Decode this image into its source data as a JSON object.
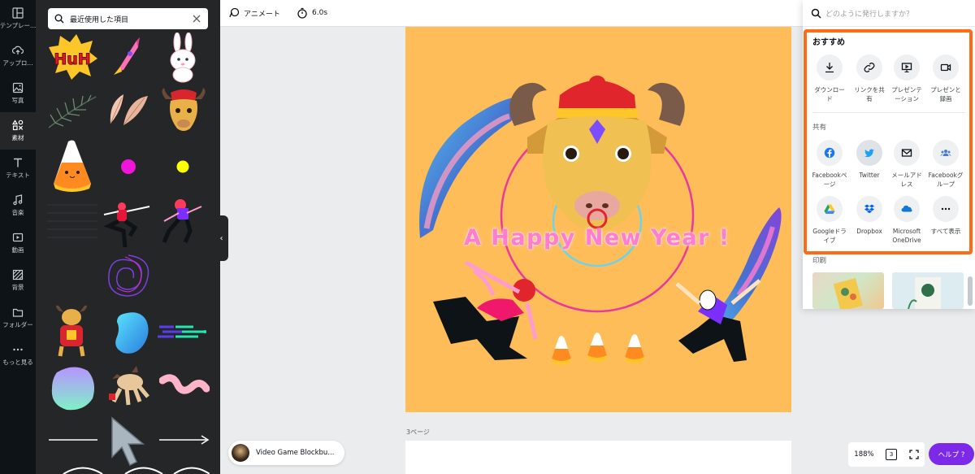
{
  "rail": [
    {
      "id": "template",
      "label": "テンプレー...",
      "icon": "template-icon"
    },
    {
      "id": "upload",
      "label": "アップロ...",
      "icon": "cloud-upload-icon"
    },
    {
      "id": "photo",
      "label": "写真",
      "icon": "photo-icon"
    },
    {
      "id": "elements",
      "label": "素材",
      "icon": "shapes-icon",
      "active": true
    },
    {
      "id": "text",
      "label": "テキスト",
      "icon": "text-icon"
    },
    {
      "id": "audio",
      "label": "音楽",
      "icon": "music-icon"
    },
    {
      "id": "video",
      "label": "動画",
      "icon": "video-icon"
    },
    {
      "id": "background",
      "label": "背景",
      "icon": "background-icon"
    },
    {
      "id": "folder",
      "label": "フォルダー",
      "icon": "folder-icon"
    },
    {
      "id": "more",
      "label": "もっと見る",
      "icon": "more-icon"
    }
  ],
  "panel": {
    "search_query": "最近使用した項目"
  },
  "toolbar": {
    "animate_label": "アニメート",
    "duration": "6.0s"
  },
  "canvas": {
    "title": "A Happy New Year !"
  },
  "page_label": "3ページ",
  "audio_track": "Video Game Blockbu...",
  "zoom": "188%",
  "page_count": "3",
  "help_label": "ヘルプ ?",
  "share": {
    "search_placeholder": "どのように発行しますか？",
    "recommended_title": "おすすめ",
    "recommended": [
      {
        "label": "ダウンロード",
        "icon": "download-icon"
      },
      {
        "label": "リンクを共有",
        "icon": "link-icon"
      },
      {
        "label": "プレゼンテーション",
        "icon": "present-icon"
      },
      {
        "label": "プレゼンと録画",
        "icon": "record-icon"
      }
    ],
    "share_title": "共有",
    "share_items": [
      {
        "label": "Facebookページ",
        "icon": "facebook-icon",
        "color": "#1877f2"
      },
      {
        "label": "Twitter",
        "icon": "twitter-icon",
        "color": "#1da1f2"
      },
      {
        "label": "メールアドレス",
        "icon": "mail-icon",
        "color": "#3c4043"
      },
      {
        "label": "Facebookグループ",
        "icon": "facebook-group-icon",
        "color": "#4a7cd3"
      },
      {
        "label": "Googleドライブ",
        "icon": "google-drive-icon",
        "color": "#1fa463"
      },
      {
        "label": "Dropbox",
        "icon": "dropbox-icon",
        "color": "#0061fe"
      },
      {
        "label": "Microsoft OneDrive",
        "icon": "onedrive-icon",
        "color": "#0f78d4"
      },
      {
        "label": "すべて表示",
        "icon": "more-horizontal-icon",
        "color": "#3c4043"
      }
    ],
    "print_title": "印刷"
  },
  "colors": {
    "accent": "#7d2ae8",
    "canvas_bg": "#ffbd59",
    "highlight": "#ff6a14",
    "title_pink": "#ff7ccf"
  }
}
